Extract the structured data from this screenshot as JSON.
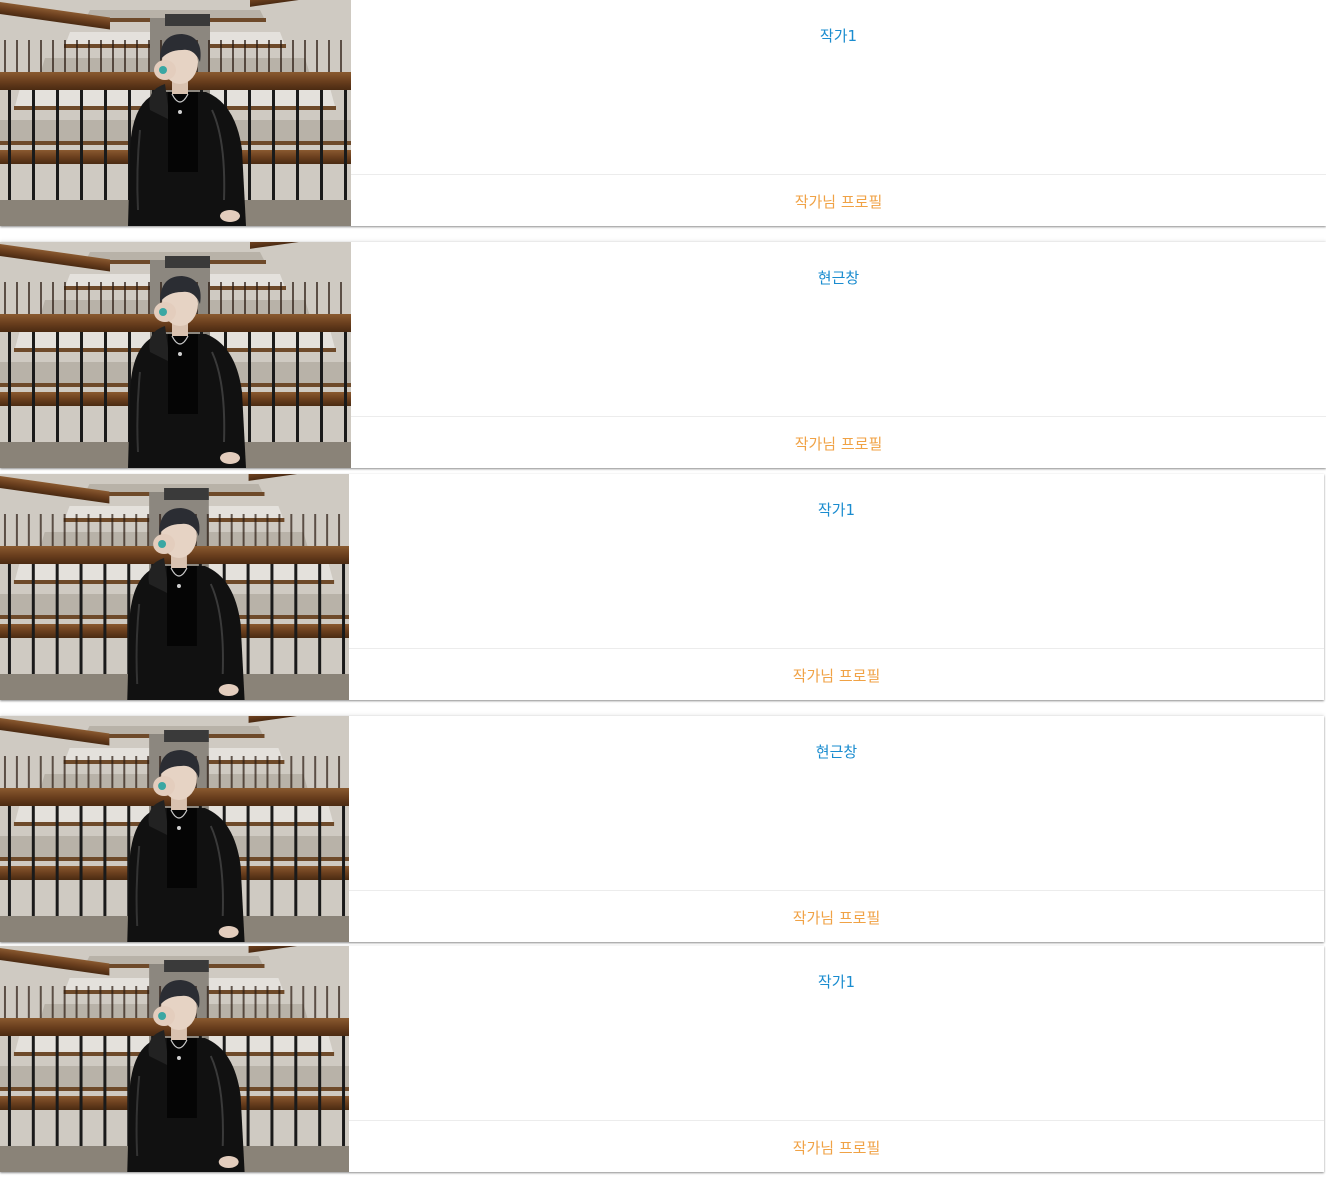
{
  "cards": [
    {
      "name": "작가1",
      "profile_link": "작가님 프로필"
    },
    {
      "name": "현근창",
      "profile_link": "작가님 프로필"
    },
    {
      "name": "작가1",
      "profile_link": "작가님 프로필"
    },
    {
      "name": "현근창",
      "profile_link": "작가님 프로필"
    },
    {
      "name": "작가1",
      "profile_link": "작가님 프로필"
    }
  ],
  "colors": {
    "name_text": "#1a8ccf",
    "profile_link_text": "#f0a245"
  }
}
